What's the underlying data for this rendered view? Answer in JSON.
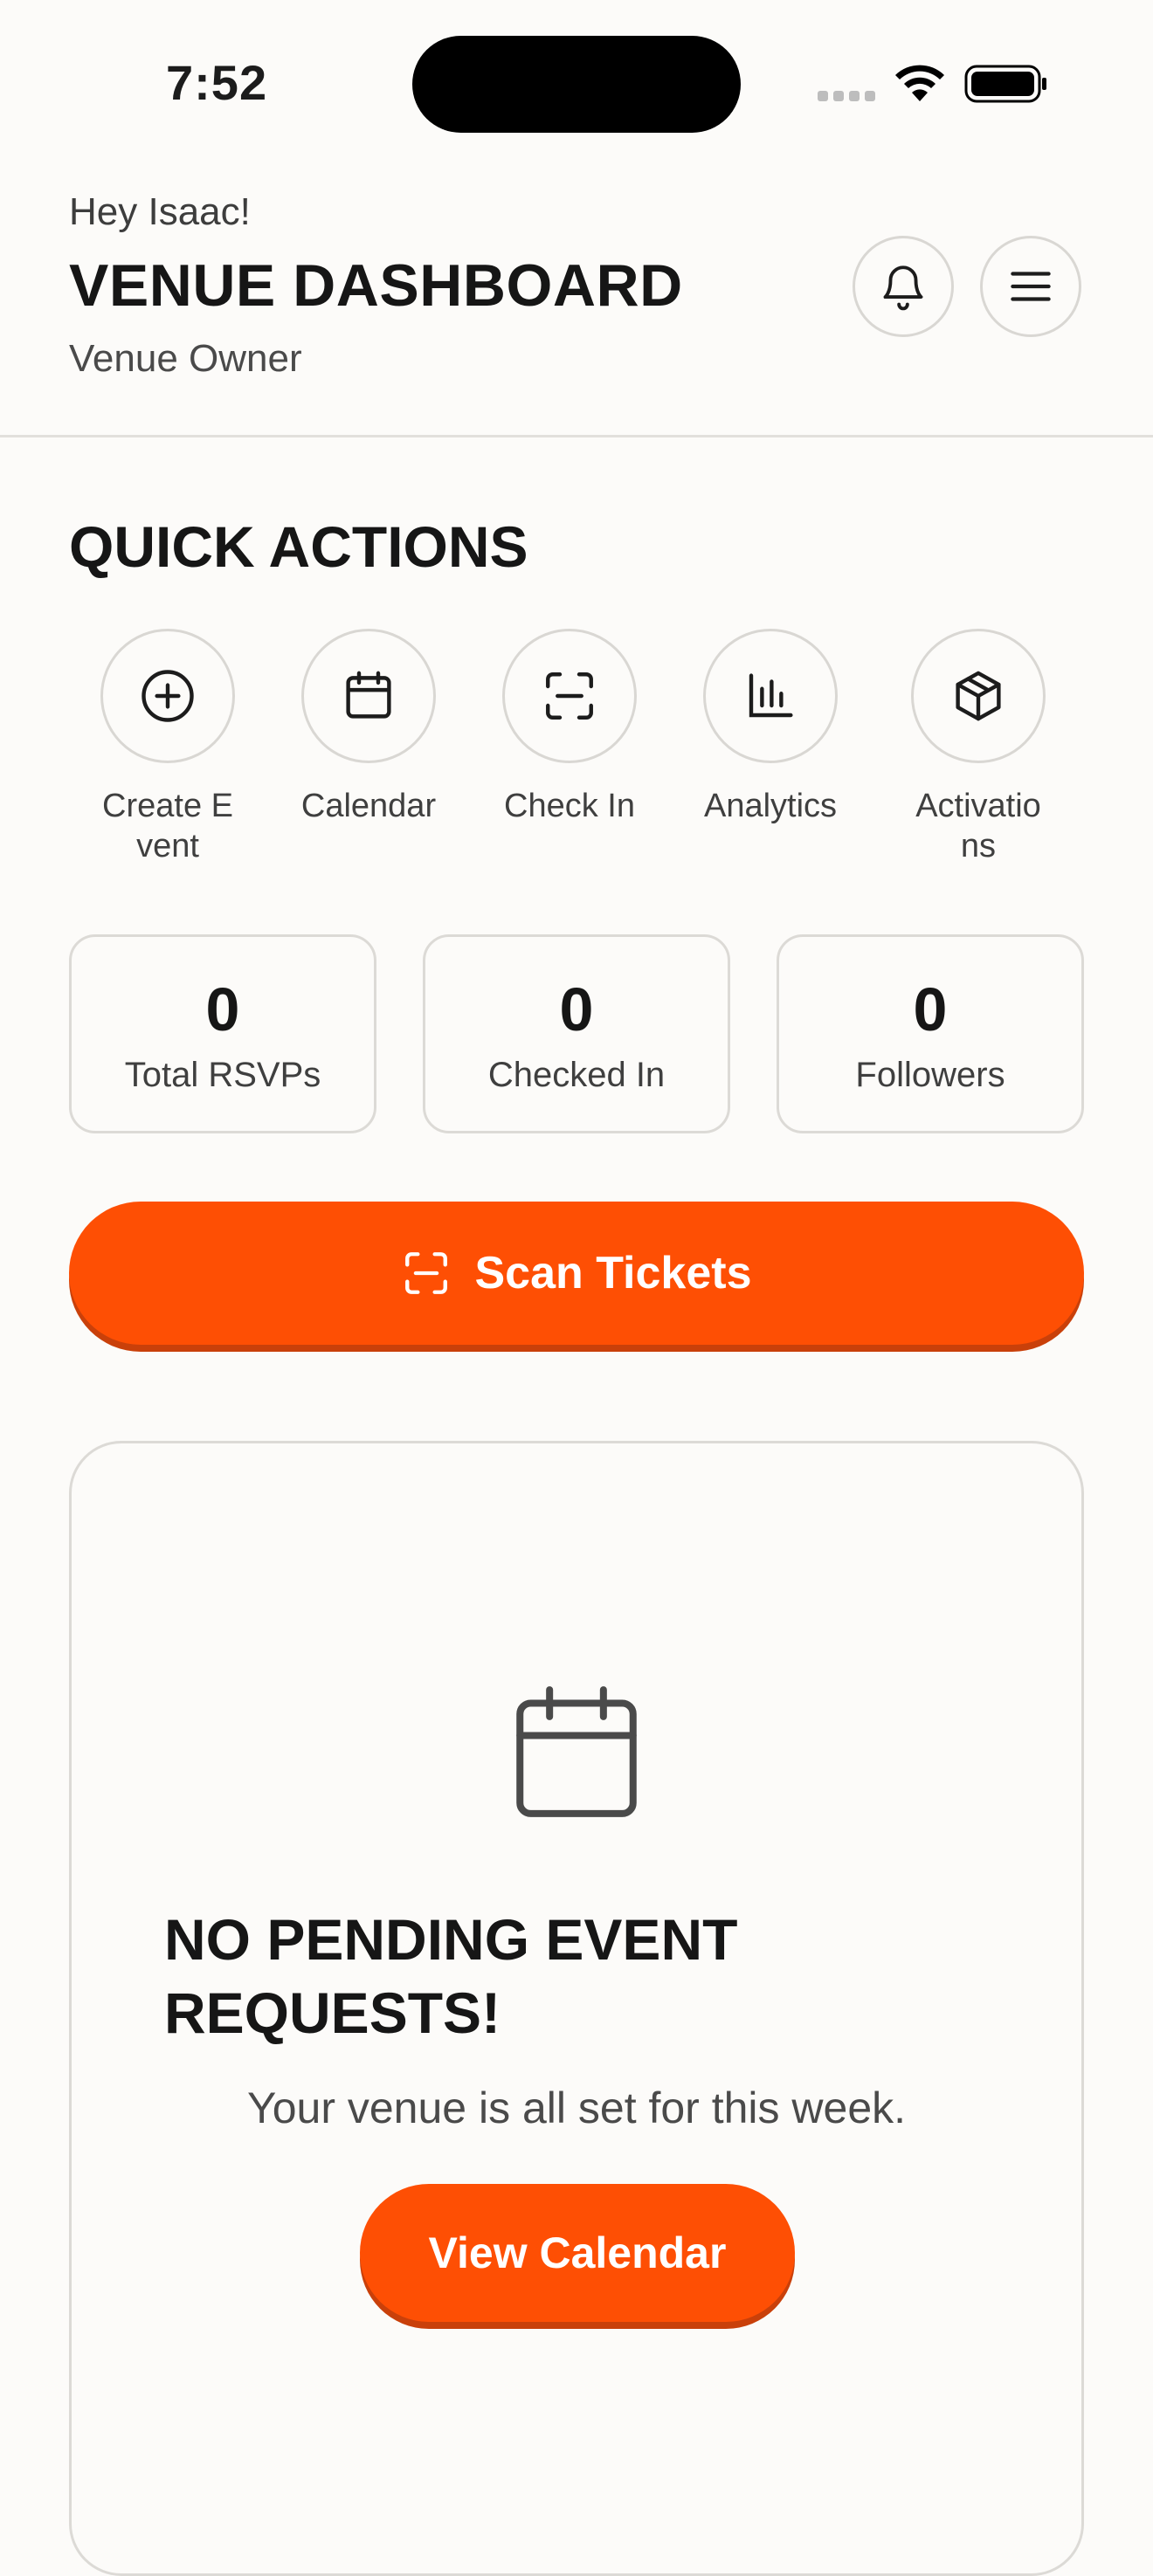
{
  "status_bar": {
    "time": "7:52",
    "icons": [
      "cellular-signal-icon",
      "wifi-icon",
      "battery-icon"
    ]
  },
  "header": {
    "greeting": "Hey Isaac!",
    "title": "VENUE DASHBOARD",
    "role": "Venue Owner",
    "buttons": [
      "bell-icon",
      "menu-icon"
    ]
  },
  "quick_actions": {
    "title": "QUICK ACTIONS",
    "items": [
      {
        "label": "Create Event",
        "icon": "plus-circle-icon"
      },
      {
        "label": "Calendar",
        "icon": "calendar-icon"
      },
      {
        "label": "Check In",
        "icon": "scan-icon"
      },
      {
        "label": "Analytics",
        "icon": "bar-chart-icon"
      },
      {
        "label": "Activations",
        "icon": "box-icon"
      }
    ]
  },
  "stats": [
    {
      "value": "0",
      "label": "Total RSVPs"
    },
    {
      "value": "0",
      "label": "Checked In"
    },
    {
      "value": "0",
      "label": "Followers"
    }
  ],
  "scan_button": {
    "label": "Scan Tickets",
    "icon": "scan-icon"
  },
  "empty_state": {
    "icon": "calendar-icon",
    "title": "NO PENDING EVENT REQUESTS!",
    "subtitle": "Your venue is all set for this week.",
    "button_label": "View Calendar"
  },
  "colors": {
    "accent": "#fe4f04",
    "background": "#fcfbf9",
    "border": "#dcdad6",
    "text": "#161616"
  }
}
